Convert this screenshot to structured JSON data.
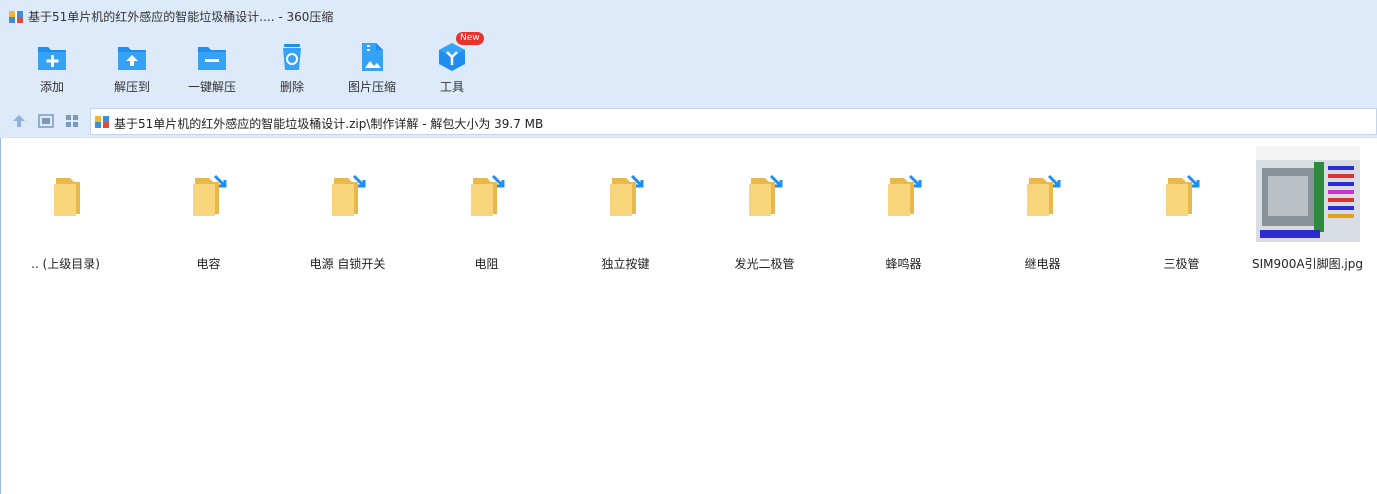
{
  "window": {
    "title": "基于51单片机的红外感应的智能垃圾桶设计.... - 360压缩"
  },
  "toolbar": {
    "items": [
      {
        "label": "添加",
        "icon": "add-icon"
      },
      {
        "label": "解压到",
        "icon": "extract-to-icon"
      },
      {
        "label": "一键解压",
        "icon": "one-click-extract-icon"
      },
      {
        "label": "删除",
        "icon": "delete-icon"
      },
      {
        "label": "图片压缩",
        "icon": "image-compress-icon"
      },
      {
        "label": "工具",
        "icon": "tools-icon",
        "badge": "New"
      }
    ]
  },
  "address": {
    "path": "基于51单片机的红外感应的智能垃圾桶设计.zip\\制作详解 - 解包大小为 39.7 MB"
  },
  "files": [
    {
      "name": ".. (上级目录)",
      "type": "parent-folder"
    },
    {
      "name": "电容",
      "type": "folder"
    },
    {
      "name": "电源 自锁开关",
      "type": "folder"
    },
    {
      "name": "电阻",
      "type": "folder"
    },
    {
      "name": "独立按键",
      "type": "folder"
    },
    {
      "name": "发光二极管",
      "type": "folder"
    },
    {
      "name": "蜂鸣器",
      "type": "folder"
    },
    {
      "name": "继电器",
      "type": "folder"
    },
    {
      "name": "三极管",
      "type": "folder"
    },
    {
      "name": "SIM900A引脚图.jpg",
      "type": "image"
    }
  ],
  "colors": {
    "chrome": "#ddeaf9",
    "accent": "#1e8ff0",
    "folder": "#f5cc6a",
    "badge": "#e8322b"
  }
}
